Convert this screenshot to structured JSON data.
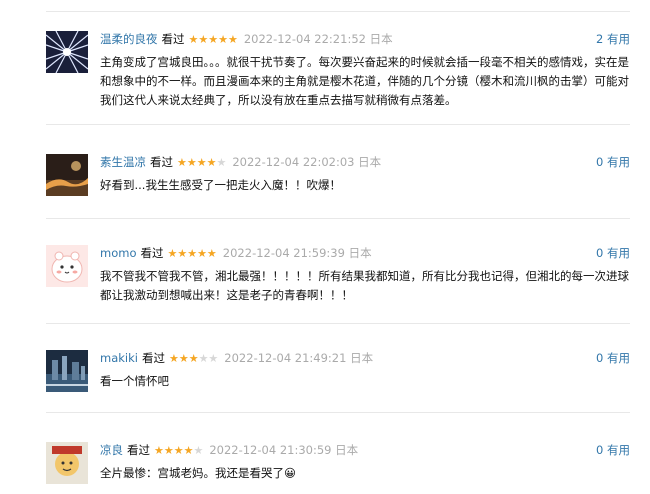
{
  "comments": [
    {
      "user": "温柔的良夜",
      "watched": "看过",
      "rating": 5,
      "time": "2022-12-04 22:21:52 日本",
      "useful": "2 有用",
      "text": "主角变成了宫城良田。。。就很干扰节奏了。每次要兴奋起来的时候就会插一段毫不相关的感情戏，实在是和想象中的不一样。而且漫画本来的主角就是樱木花道，伴随的几个分镜（樱木和流川枫的击掌）可能对我们这代人来说太经典了，所以没有放在重点去描写就稍微有点落差。"
    },
    {
      "user": "素生温凉",
      "watched": "看过",
      "rating": 4,
      "time": "2022-12-04 22:02:03 日本",
      "useful": "0 有用",
      "text": "好看到...我生生感受了一把走火入魔！！吹爆！"
    },
    {
      "user": "momo",
      "watched": "看过",
      "rating": 5,
      "time": "2022-12-04 21:59:39 日本",
      "useful": "0 有用",
      "text": "我不管我不管我不管，湘北最强！！！！！所有结果我都知道，所有比分我也记得，但湘北的每一次进球都让我激动到想喊出来！这是老子的青春啊！！！"
    },
    {
      "user": "makiki",
      "watched": "看过",
      "rating": 3,
      "time": "2022-12-04 21:49:21 日本",
      "useful": "0 有用",
      "text": "看一个情怀吧"
    },
    {
      "user": "凉良",
      "watched": "看过",
      "rating": 4,
      "time": "2022-12-04 21:30:59 日本",
      "useful": "0 有用",
      "text": "全片最惨：宫城老妈。我还是看哭了😀"
    }
  ]
}
